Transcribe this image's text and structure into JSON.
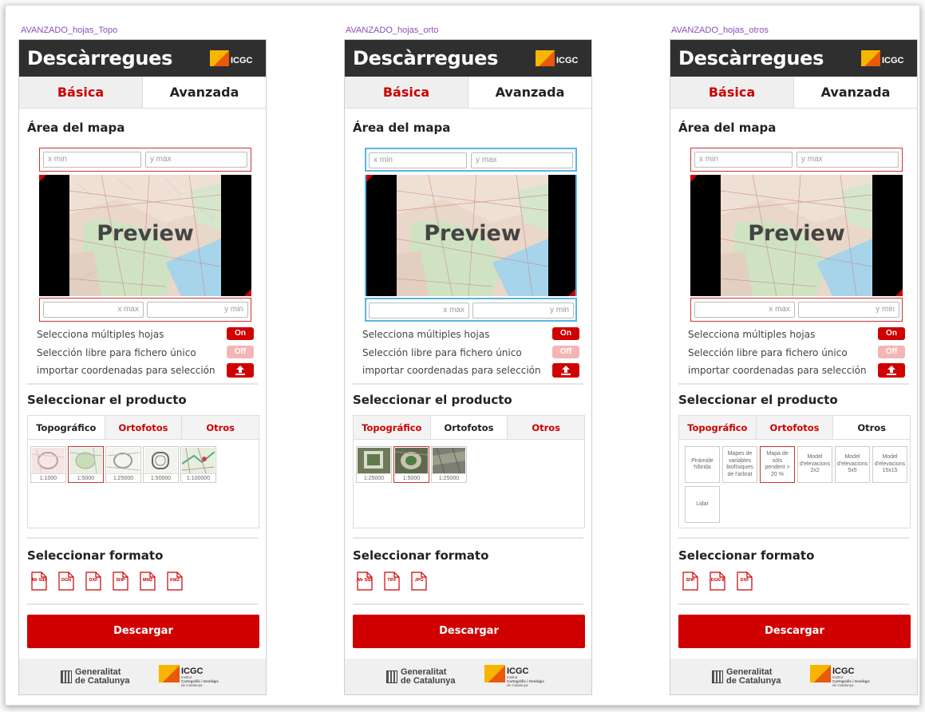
{
  "brand": {
    "logo_text": "ICGC",
    "accent": "#d10000",
    "header_bg": "#2f2f2f"
  },
  "panels": [
    {
      "label": "AVANZADO_hojas_Topo",
      "header_title": "Descàrregues",
      "tab_basic": "Básica",
      "tab_advanced": "Avanzada",
      "area_title": "Área del mapa",
      "xmin_placeholder": "x min",
      "ymax_placeholder": "y max",
      "xmax_placeholder": "x max",
      "ymin_placeholder": "y min",
      "preview_label": "Preview",
      "opt_multi": "Selecciona múltiples hojas",
      "opt_free": "Selección libre para fichero único",
      "opt_import": "importar coordenadas para selección",
      "toggle_on": "On",
      "toggle_off": "Off",
      "product_title": "Seleccionar el producto",
      "product_tabs": [
        "Topográfico",
        "Ortofotos",
        "Otros"
      ],
      "active_product_tab": "Topográfico",
      "scales": [
        "1:1000",
        "1:5000",
        "1:25000",
        "1:50000",
        "1:100000"
      ],
      "selected_scale": "1:5000",
      "format_title": "Seleccionar formato",
      "formats": [
        "Mr SID",
        "DGN",
        "DXF",
        "SHP",
        "MMZ",
        "KMZ"
      ],
      "download_label": "Descargar",
      "footer_gen_1": "Generalitat",
      "footer_gen_2": "de Catalunya",
      "footer_icgc": "ICGC",
      "footer_icgc_sub1": "Institut",
      "footer_icgc_sub2": "Cartogràfic i Geològic",
      "footer_icgc_sub3": "de Catalunya"
    },
    {
      "label": "AVANZADO_hojas_orto",
      "header_title": "Descàrregues",
      "tab_basic": "Básica",
      "tab_advanced": "Avanzada",
      "area_title": "Área del mapa",
      "xmin_placeholder": "x min",
      "ymax_placeholder": "y max",
      "xmax_placeholder": "x max",
      "ymin_placeholder": "y min",
      "preview_label": "Preview",
      "opt_multi": "Selecciona múltiples hojas",
      "opt_free": "Selección libre para fichero único",
      "opt_import": "importar coordenadas para selección",
      "toggle_on": "On",
      "toggle_off": "Off",
      "product_title": "Seleccionar el producto",
      "product_tabs": [
        "Topográfico",
        "Ortofotos",
        "Otros"
      ],
      "active_product_tab": "Ortofotos",
      "scales": [
        "1:25000",
        "1:5000",
        "1:25000"
      ],
      "selected_scale": "1:5000",
      "format_title": "Seleccionar formato",
      "formats": [
        "Mr SID",
        "TIFF",
        "JPG"
      ],
      "download_label": "Descargar",
      "footer_gen_1": "Generalitat",
      "footer_gen_2": "de Catalunya",
      "footer_icgc": "ICGC",
      "footer_icgc_sub1": "Institut",
      "footer_icgc_sub2": "Cartogràfic i Geològic",
      "footer_icgc_sub3": "de Catalunya"
    },
    {
      "label": "AVANZADO_hojas_otros",
      "header_title": "Descàrregues",
      "tab_basic": "Básica",
      "tab_advanced": "Avanzada",
      "area_title": "Área del mapa",
      "xmin_placeholder": "x min",
      "ymax_placeholder": "y max",
      "xmax_placeholder": "x max",
      "ymin_placeholder": "y min",
      "preview_label": "Preview",
      "opt_multi": "Selecciona múltiples hojas",
      "opt_free": "Selección libre para fichero único",
      "opt_import": "importar coordenadas para selección",
      "toggle_on": "On",
      "toggle_off": "Off",
      "product_title": "Seleccionar el producto",
      "product_tabs": [
        "Topográfico",
        "Ortofotos",
        "Otros"
      ],
      "active_product_tab": "Otros",
      "other_items": [
        "Pirámide híbrida",
        "Mapes de variables biofísiques de l'arbrat",
        "Mapa de sòls pendent > 20 %",
        "Model d'elevacions 2x2",
        "Model d'elevacions 5x5",
        "Model d'elevacions 15x15",
        "Lidar"
      ],
      "selected_other": "Mapa de sòls pendent > 20 %",
      "format_title": "Seleccionar formato",
      "formats": [
        "SHP",
        "DGN 8",
        "DXF"
      ],
      "download_label": "Descargar",
      "footer_gen_1": "Generalitat",
      "footer_gen_2": "de Catalunya",
      "footer_icgc": "ICGC",
      "footer_icgc_sub1": "Institut",
      "footer_icgc_sub2": "Cartogràfic i Geològic",
      "footer_icgc_sub3": "de Catalunya"
    }
  ]
}
